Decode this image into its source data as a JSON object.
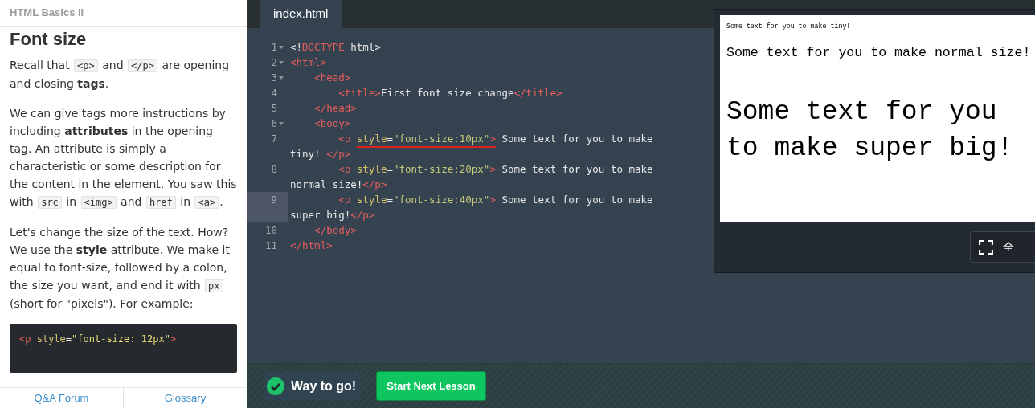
{
  "lesson": {
    "course": "HTML Basics II",
    "heading": "Font size",
    "paragraphs": [
      [
        {
          "kind": "text",
          "text": "Recall that "
        },
        {
          "kind": "code",
          "text": "<p>"
        },
        {
          "kind": "text",
          "text": " and "
        },
        {
          "kind": "code",
          "text": "</p>"
        },
        {
          "kind": "text",
          "text": " are opening and closing **tags**."
        }
      ],
      [
        {
          "kind": "text",
          "text": "We can give tags more instructions by including **attributes** in the opening tag. An attribute is simply a characteristic or some description for the content in the element. You saw this with "
        },
        {
          "kind": "code",
          "text": "src"
        },
        {
          "kind": "text",
          "text": " in "
        },
        {
          "kind": "code",
          "text": "<img>"
        },
        {
          "kind": "text",
          "text": " and "
        },
        {
          "kind": "code",
          "text": "href"
        },
        {
          "kind": "text",
          "text": " in "
        },
        {
          "kind": "code",
          "text": "<a>"
        },
        {
          "kind": "text",
          "text": "."
        }
      ],
      [
        {
          "kind": "text",
          "text": "Let's change the size of the text. How? We use the **style** attribute. We make it equal to font-size, followed by a colon, the size you want, and end it with "
        },
        {
          "kind": "code",
          "text": "px"
        },
        {
          "kind": "text",
          "text": " (short for \"pixels\"). For example:"
        }
      ]
    ],
    "example": [
      {
        "kind": "tag",
        "text": "<p "
      },
      {
        "kind": "attr",
        "text": "style"
      },
      {
        "kind": "text",
        "text": "="
      },
      {
        "kind": "string",
        "text": "\"font-size: 12px\""
      },
      {
        "kind": "tag",
        "text": ">"
      }
    ],
    "footer_links": [
      "Q&A Forum",
      "Glossary"
    ]
  },
  "editor": {
    "tabs": [
      {
        "label": "index.html",
        "selected": true
      }
    ],
    "lines": [
      {
        "number": "1",
        "foldable": true,
        "active": false,
        "tokens": [
          {
            "kind": "text",
            "text": "<!"
          },
          {
            "kind": "tag",
            "text": "DOCTYPE"
          },
          {
            "kind": "text",
            "text": " html>"
          }
        ]
      },
      {
        "number": "2",
        "foldable": true,
        "active": false,
        "tokens": [
          {
            "kind": "tag",
            "text": "<html>"
          }
        ]
      },
      {
        "number": "3",
        "foldable": true,
        "active": false,
        "tokens": [
          {
            "kind": "tag",
            "text": "    <head>"
          }
        ]
      },
      {
        "number": "4",
        "foldable": false,
        "active": false,
        "tokens": [
          {
            "kind": "tag",
            "text": "        <title>"
          },
          {
            "kind": "text",
            "text": "First font size change"
          },
          {
            "kind": "tag",
            "text": "</title>"
          }
        ]
      },
      {
        "number": "5",
        "foldable": false,
        "active": false,
        "tokens": [
          {
            "kind": "tag",
            "text": "    </head>"
          }
        ]
      },
      {
        "number": "6",
        "foldable": true,
        "active": false,
        "tokens": [
          {
            "kind": "tag",
            "text": "    <body>"
          }
        ]
      },
      {
        "number": "7",
        "foldable": false,
        "active": false,
        "tokens": [
          {
            "kind": "tag",
            "text": "        <p "
          },
          {
            "kind": "attr",
            "text": "style",
            "underlined": true
          },
          {
            "kind": "text",
            "text": "=",
            "underlined": true
          },
          {
            "kind": "string",
            "text": "\"font-size:10px\"",
            "underlined": true
          },
          {
            "kind": "tag",
            "text": ">",
            "underlined": true
          },
          {
            "kind": "text",
            "text": " Some text for you to make tiny! "
          },
          {
            "kind": "tag",
            "text": "</p>"
          }
        ]
      },
      {
        "number": "8",
        "foldable": false,
        "active": false,
        "tokens": [
          {
            "kind": "tag",
            "text": "        <p "
          },
          {
            "kind": "attr",
            "text": "style"
          },
          {
            "kind": "text",
            "text": "="
          },
          {
            "kind": "string",
            "text": "\"font-size:20px\""
          },
          {
            "kind": "tag",
            "text": ">"
          },
          {
            "kind": "text",
            "text": " Some text for you to make normal size!"
          },
          {
            "kind": "tag",
            "text": "</p>"
          }
        ]
      },
      {
        "number": "9",
        "foldable": false,
        "active": true,
        "tokens": [
          {
            "kind": "tag",
            "text": "        <p "
          },
          {
            "kind": "attr",
            "text": "style"
          },
          {
            "kind": "text",
            "text": "="
          },
          {
            "kind": "string",
            "text": "\"font-size:40px\""
          },
          {
            "kind": "tag",
            "text": ">"
          },
          {
            "kind": "text",
            "text": " Some text for you to make super big!"
          },
          {
            "kind": "tag",
            "text": "</p>"
          }
        ]
      },
      {
        "number": "10",
        "foldable": false,
        "active": false,
        "tokens": [
          {
            "kind": "tag",
            "text": "    </body>"
          }
        ]
      },
      {
        "number": "11",
        "foldable": false,
        "active": false,
        "tokens": [
          {
            "kind": "tag",
            "text": "</html>"
          }
        ]
      }
    ]
  },
  "preview": {
    "paragraphs": [
      {
        "kind": "tiny",
        "text": "Some text for you to make tiny!"
      },
      {
        "kind": "normal",
        "text": "Some text for you to make normal size!"
      },
      {
        "kind": "big",
        "text": "Some text for you to make super big!"
      }
    ],
    "fullscreen_label": "全"
  },
  "status": {
    "message": "Way to go!",
    "button": "Start Next Lesson"
  }
}
